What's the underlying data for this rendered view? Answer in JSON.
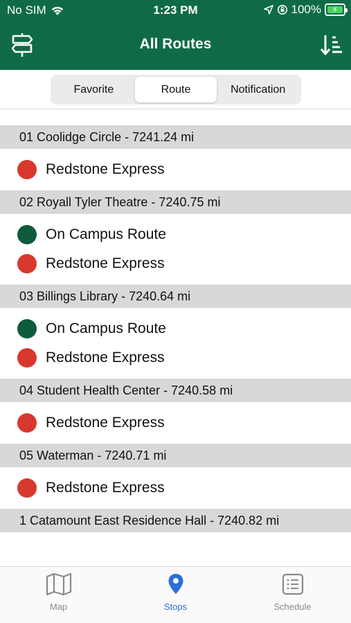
{
  "status_bar": {
    "carrier": "No SIM",
    "time": "1:23 PM",
    "battery": "100%"
  },
  "nav": {
    "title": "All Routes",
    "left_icon": "signpost-icon",
    "right_icon": "sort-icon"
  },
  "segments": [
    {
      "label": "Favorite",
      "active": false
    },
    {
      "label": "Route",
      "active": true
    },
    {
      "label": "Notification",
      "active": false
    }
  ],
  "route_colors": {
    "On Campus Route": "#0f5b3c",
    "Redstone Express": "#d8372d"
  },
  "stops": [
    {
      "title": "01 Coolidge Circle - 7241.24 mi",
      "routes": [
        "Redstone Express"
      ]
    },
    {
      "title": "02 Royall Tyler Theatre - 7240.75 mi",
      "routes": [
        "On Campus Route",
        "Redstone Express"
      ]
    },
    {
      "title": "03 Billings Library - 7240.64 mi",
      "routes": [
        "On Campus Route",
        "Redstone Express"
      ]
    },
    {
      "title": "04 Student Health Center - 7240.58 mi",
      "routes": [
        "Redstone Express"
      ]
    },
    {
      "title": "05 Waterman - 7240.71 mi",
      "routes": [
        "Redstone Express"
      ]
    },
    {
      "title": "1 Catamount East Residence Hall - 7240.82 mi",
      "routes": []
    }
  ],
  "tabbar": [
    {
      "label": "Map",
      "icon": "map-icon",
      "active": false
    },
    {
      "label": "Stops",
      "icon": "location-pin-icon",
      "active": true
    },
    {
      "label": "Schedule",
      "icon": "schedule-list-icon",
      "active": false
    }
  ]
}
